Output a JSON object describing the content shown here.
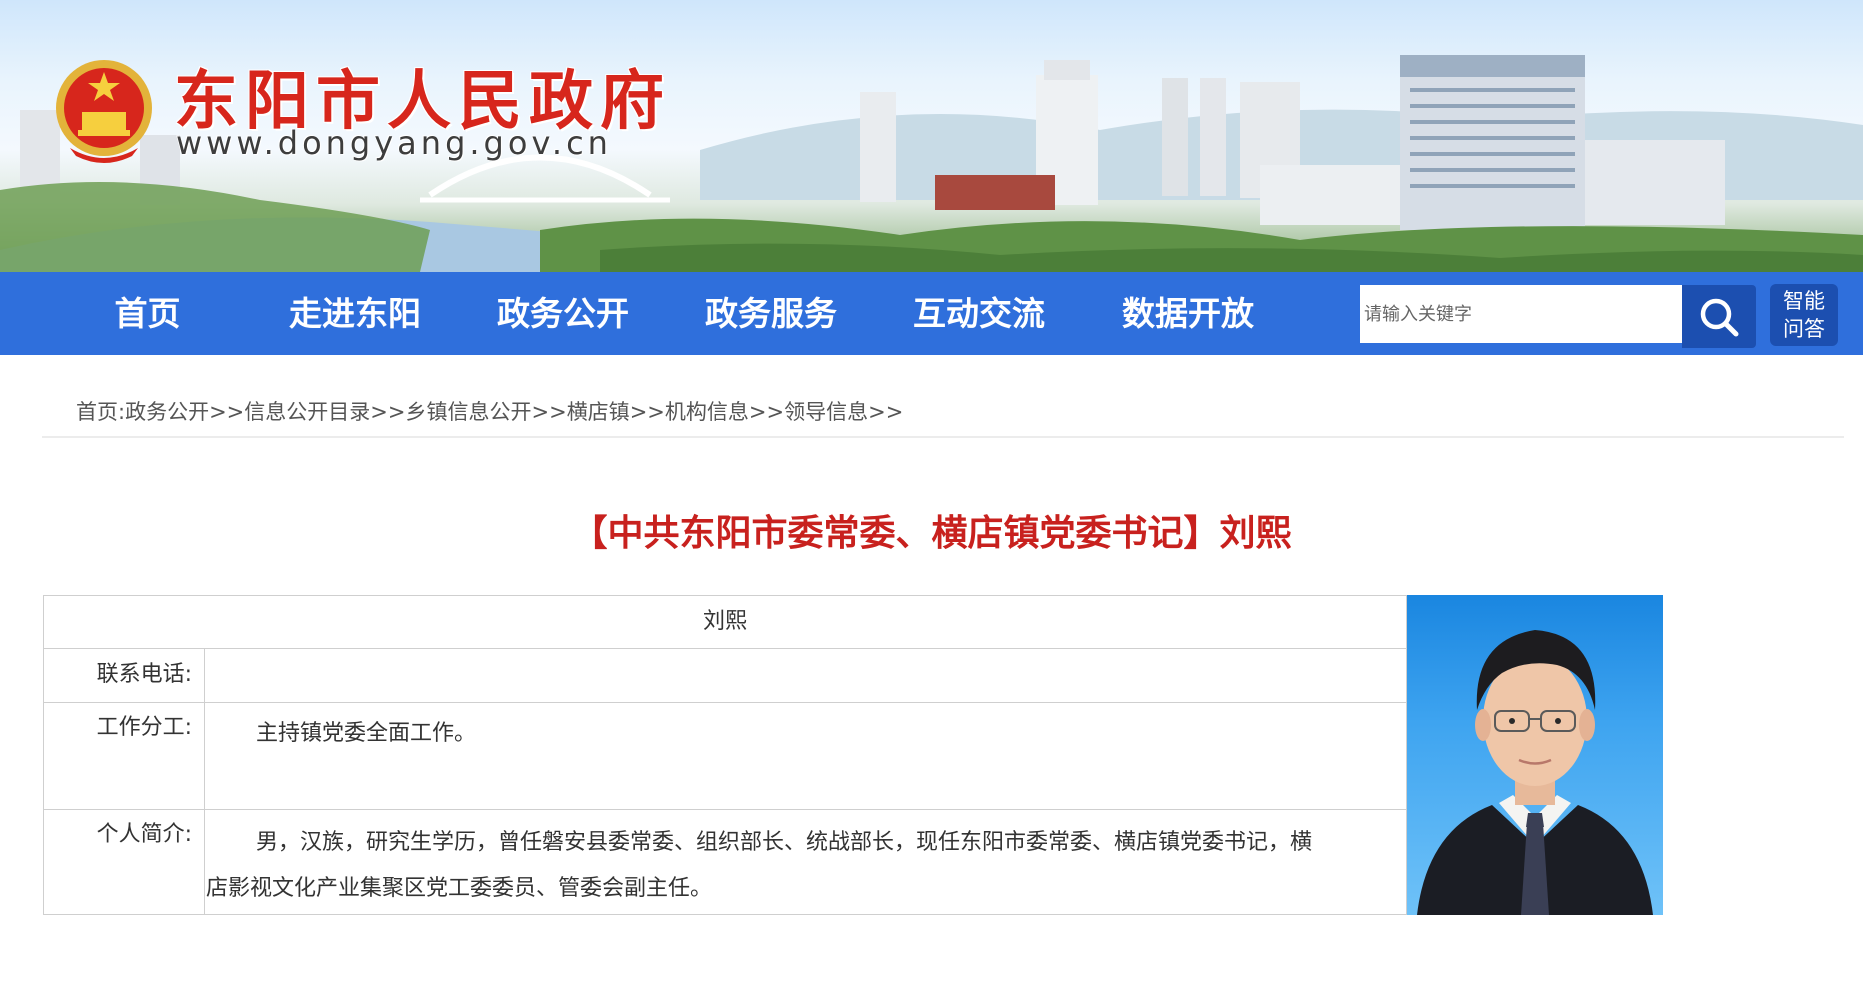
{
  "site": {
    "name": "东阳市人民政府",
    "url": "www.dongyang.gov.cn"
  },
  "nav": {
    "items": [
      {
        "label": "首页"
      },
      {
        "label": "走进东阳"
      },
      {
        "label": "政务公开"
      },
      {
        "label": "政务服务"
      },
      {
        "label": "互动交流"
      },
      {
        "label": "数据开放"
      }
    ],
    "search_placeholder": "请输入关键字",
    "ai_line1": "智能",
    "ai_line2": "问答"
  },
  "breadcrumb": {
    "items": [
      {
        "label": "首页"
      },
      {
        "label": "政务公开"
      },
      {
        "label": "信息公开目录"
      },
      {
        "label": "乡镇信息公开"
      },
      {
        "label": "横店镇"
      },
      {
        "label": "机构信息"
      },
      {
        "label": "领导信息"
      }
    ],
    "first_sep": ":",
    "sep": ">>"
  },
  "page_title": "【中共东阳市委常委、横店镇党委书记】刘熙",
  "leader": {
    "name": "刘熙",
    "phone_label": "联系电话:",
    "phone_value": "",
    "duty_label": "工作分工:",
    "duty_value": "主持镇党委全面工作。",
    "bio_label": "个人简介:",
    "bio_line1": "男，汉族，研究生学历，曾任磐安县委常委、组织部长、统战部长，现任东阳市委常委、横店镇党委书记，横",
    "bio_line2": "店影视文化产业集聚区党工委委员、管委会副主任。"
  },
  "colors": {
    "nav_bg": "#2f6fdc",
    "brand_red": "#d7261c",
    "title_red": "#c8211e",
    "search_button": "#1c4fb0"
  },
  "icons": {
    "emblem": "national-emblem-icon",
    "search": "search-icon"
  }
}
